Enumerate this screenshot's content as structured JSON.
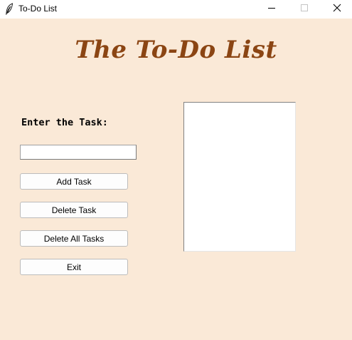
{
  "window": {
    "title": "To-Do List",
    "app_icon": "feather-icon",
    "controls": {
      "minimize_icon": "minimize-icon",
      "maximize_icon": "maximize-icon",
      "close_icon": "close-icon"
    }
  },
  "main": {
    "heading": "The To-Do List",
    "task_label": "Enter the Task:",
    "task_input_value": "",
    "buttons": {
      "add": "Add Task",
      "delete": "Delete Task",
      "delete_all": "Delete All Tasks",
      "exit": "Exit"
    },
    "tasks": []
  },
  "colors": {
    "background": "#fae9d7",
    "heading": "#8b4513",
    "listbox": "#ffffff"
  }
}
